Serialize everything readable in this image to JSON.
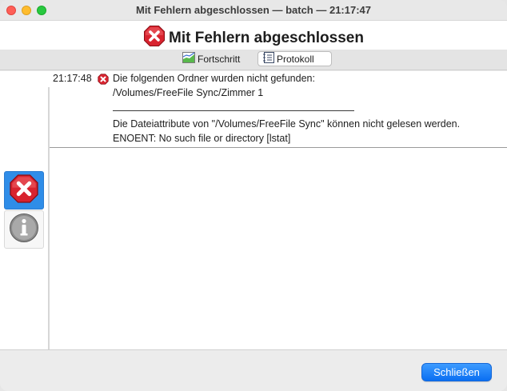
{
  "window": {
    "title": "Mit Fehlern abgeschlossen — batch — 21:17:47"
  },
  "header": {
    "title": "Mit Fehlern abgeschlossen",
    "icon": "error-icon",
    "error_color": "#d8232f"
  },
  "tabs": [
    {
      "label": "Fortschritt",
      "icon": "progress-chart-icon",
      "selected": false
    },
    {
      "label": "Protokoll",
      "icon": "log-list-icon",
      "selected": true
    }
  ],
  "filters": [
    {
      "type": "error",
      "icon": "error-icon",
      "active": true
    },
    {
      "type": "info",
      "icon": "info-icon",
      "active": false
    }
  ],
  "log": {
    "time": "21:17:48",
    "icon": "error-icon",
    "lines": [
      "Die folgenden Ordner wurden nicht gefunden:",
      "/Volumes/FreeFile Sync/Zimmer 1",
      "",
      "Die Dateiattribute von \"/Volumes/FreeFile Sync\" können nicht gelesen werden.",
      "ENOENT: No such file or directory [lstat]"
    ]
  },
  "footer": {
    "close_label": "Schließen",
    "accent": "#0a6ff2"
  }
}
